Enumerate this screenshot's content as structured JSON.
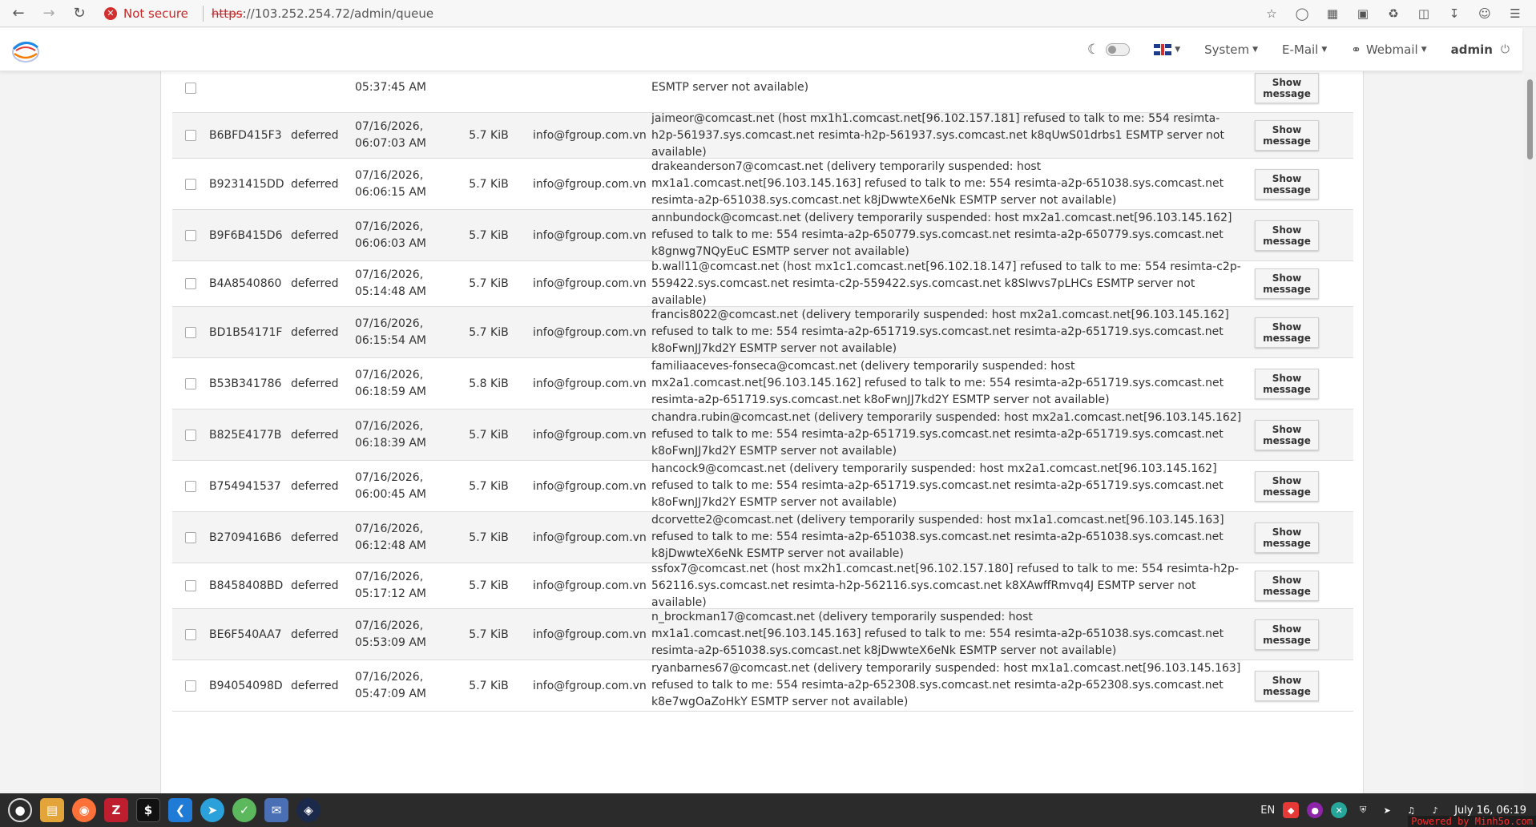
{
  "browser": {
    "security_label": "Not secure",
    "url_protocol": "https",
    "url_rest": "://103.252.254.72/admin/queue"
  },
  "navbar": {
    "system": "System",
    "email": "E-Mail",
    "webmail": "Webmail",
    "user": "admin"
  },
  "queue": {
    "rows": [
      {
        "id": "",
        "status": "",
        "date": "",
        "time": "05:37:45 AM",
        "size": "",
        "from": "",
        "message": "ESMTP server not available)",
        "button": "Show message"
      },
      {
        "id": "B6BFD415F3",
        "status": "deferred",
        "date": "07/16/2026,",
        "time": "06:07:03 AM",
        "size": "5.7 KiB",
        "from": "info@fgroup.com.vn",
        "message": "jaimeor@comcast.net (host mx1h1.comcast.net[96.102.157.181] refused to talk to me: 554 resimta-h2p-561937.sys.comcast.net resimta-h2p-561937.sys.comcast.net k8qUwS01drbs1 ESMTP server not available)",
        "button": "Show message"
      },
      {
        "id": "B9231415DD",
        "status": "deferred",
        "date": "07/16/2026,",
        "time": "06:06:15 AM",
        "size": "5.7 KiB",
        "from": "info@fgroup.com.vn",
        "message": "drakeanderson7@comcast.net (delivery temporarily suspended: host mx1a1.comcast.net[96.103.145.163] refused to talk to me: 554 resimta-a2p-651038.sys.comcast.net resimta-a2p-651038.sys.comcast.net k8jDwwteX6eNk ESMTP server not available)",
        "button": "Show message"
      },
      {
        "id": "B9F6B415D6",
        "status": "deferred",
        "date": "07/16/2026,",
        "time": "06:06:03 AM",
        "size": "5.7 KiB",
        "from": "info@fgroup.com.vn",
        "message": "annbundock@comcast.net (delivery temporarily suspended: host mx2a1.comcast.net[96.103.145.162] refused to talk to me: 554 resimta-a2p-650779.sys.comcast.net resimta-a2p-650779.sys.comcast.net k8gnwg7NQyEuC ESMTP server not available)",
        "button": "Show message"
      },
      {
        "id": "B4A8540860",
        "status": "deferred",
        "date": "07/16/2026,",
        "time": "05:14:48 AM",
        "size": "5.7 KiB",
        "from": "info@fgroup.com.vn",
        "message": "b.wall11@comcast.net (host mx1c1.comcast.net[96.102.18.147] refused to talk to me: 554 resimta-c2p-559422.sys.comcast.net resimta-c2p-559422.sys.comcast.net k8SIwvs7pLHCs ESMTP server not available)",
        "button": "Show message"
      },
      {
        "id": "BD1B54171F",
        "status": "deferred",
        "date": "07/16/2026,",
        "time": "06:15:54 AM",
        "size": "5.7 KiB",
        "from": "info@fgroup.com.vn",
        "message": "francis8022@comcast.net (delivery temporarily suspended: host mx2a1.comcast.net[96.103.145.162] refused to talk to me: 554 resimta-a2p-651719.sys.comcast.net resimta-a2p-651719.sys.comcast.net k8oFwnJJ7kd2Y ESMTP server not available)",
        "button": "Show message"
      },
      {
        "id": "B53B341786",
        "status": "deferred",
        "date": "07/16/2026,",
        "time": "06:18:59 AM",
        "size": "5.8 KiB",
        "from": "info@fgroup.com.vn",
        "message": "familiaaceves-fonseca@comcast.net (delivery temporarily suspended: host mx2a1.comcast.net[96.103.145.162] refused to talk to me: 554 resimta-a2p-651719.sys.comcast.net resimta-a2p-651719.sys.comcast.net k8oFwnJJ7kd2Y ESMTP server not available)",
        "button": "Show message"
      },
      {
        "id": "B825E4177B",
        "status": "deferred",
        "date": "07/16/2026,",
        "time": "06:18:39 AM",
        "size": "5.7 KiB",
        "from": "info@fgroup.com.vn",
        "message": "chandra.rubin@comcast.net (delivery temporarily suspended: host mx2a1.comcast.net[96.103.145.162] refused to talk to me: 554 resimta-a2p-651719.sys.comcast.net resimta-a2p-651719.sys.comcast.net k8oFwnJJ7kd2Y ESMTP server not available)",
        "button": "Show message"
      },
      {
        "id": "B754941537",
        "status": "deferred",
        "date": "07/16/2026,",
        "time": "06:00:45 AM",
        "size": "5.7 KiB",
        "from": "info@fgroup.com.vn",
        "message": "hancock9@comcast.net (delivery temporarily suspended: host mx2a1.comcast.net[96.103.145.162] refused to talk to me: 554 resimta-a2p-651719.sys.comcast.net resimta-a2p-651719.sys.comcast.net k8oFwnJJ7kd2Y ESMTP server not available)",
        "button": "Show message"
      },
      {
        "id": "B2709416B6",
        "status": "deferred",
        "date": "07/16/2026,",
        "time": "06:12:48 AM",
        "size": "5.7 KiB",
        "from": "info@fgroup.com.vn",
        "message": "dcorvette2@comcast.net (delivery temporarily suspended: host mx1a1.comcast.net[96.103.145.163] refused to talk to me: 554 resimta-a2p-651038.sys.comcast.net resimta-a2p-651038.sys.comcast.net k8jDwwteX6eNk ESMTP server not available)",
        "button": "Show message"
      },
      {
        "id": "B8458408BD",
        "status": "deferred",
        "date": "07/16/2026,",
        "time": "05:17:12 AM",
        "size": "5.7 KiB",
        "from": "info@fgroup.com.vn",
        "message": "ssfox7@comcast.net (host mx2h1.comcast.net[96.102.157.180] refused to talk to me: 554 resimta-h2p-562116.sys.comcast.net resimta-h2p-562116.sys.comcast.net k8XAwffRmvq4J ESMTP server not available)",
        "button": "Show message"
      },
      {
        "id": "BE6F540AA7",
        "status": "deferred",
        "date": "07/16/2026,",
        "time": "05:53:09 AM",
        "size": "5.7 KiB",
        "from": "info@fgroup.com.vn",
        "message": "n_brockman17@comcast.net (delivery temporarily suspended: host mx1a1.comcast.net[96.103.145.163] refused to talk to me: 554 resimta-a2p-651038.sys.comcast.net resimta-a2p-651038.sys.comcast.net k8jDwwteX6eNk ESMTP server not available)",
        "button": "Show message"
      },
      {
        "id": "B94054098D",
        "status": "deferred",
        "date": "07/16/2026,",
        "time": "05:47:09 AM",
        "size": "5.7 KiB",
        "from": "info@fgroup.com.vn",
        "message": "ryanbarnes67@comcast.net (delivery temporarily suspended: host mx1a1.comcast.net[96.103.145.163] refused to talk to me: 554 resimta-a2p-652308.sys.comcast.net resimta-a2p-652308.sys.comcast.net k8e7wgOaZoHkY ESMTP server not available)",
        "button": "Show message"
      }
    ]
  },
  "taskbar": {
    "language": "EN",
    "clock": "July 16, 06:19",
    "watermark": "Powered by Minh5o.com"
  }
}
